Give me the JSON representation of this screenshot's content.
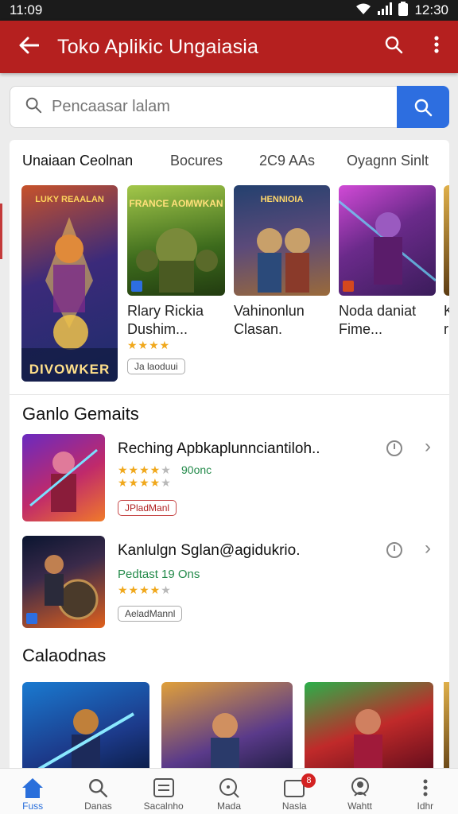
{
  "status": {
    "time": "11:09",
    "right_time": "12:30"
  },
  "appbar": {
    "title": "Toko Aplikic Ungaiasia"
  },
  "search": {
    "placeholder": "Pencaasar lalam"
  },
  "tabs": [
    "Unaiaan Ceolnan",
    "Bocures",
    "2C9 AAs",
    "Oyagnn Sinlt"
  ],
  "featured": [
    {
      "name_line1": "",
      "name_line2": "",
      "banner": "DIVOWKER",
      "banner_top": "LUKY REAALAN",
      "tag": "",
      "stars": 0,
      "colors": [
        "#1d2d6b",
        "#c7522a"
      ]
    },
    {
      "name_line1": "Rlary Rickia",
      "name_line2": "Dushim...",
      "stars": 4,
      "tag": "Ja laoduui",
      "banner_top": "FRANCE AOMWKAN",
      "colors": [
        "#3c6a1c",
        "#a3c74a"
      ]
    },
    {
      "name_line1": "Vahinonlun",
      "name_line2": "Clasan.",
      "stars": 0,
      "tag": "",
      "banner_top": "HENNIOIA",
      "colors": [
        "#23406e",
        "#9a6a3a"
      ]
    },
    {
      "name_line1": "Noda daniat",
      "name_line2": "Fime...",
      "stars": 0,
      "tag": "",
      "banner_top": "",
      "colors": [
        "#3a1c5a",
        "#d14ad6"
      ]
    },
    {
      "name_line1": "K",
      "name_line2": "r",
      "stars": 0,
      "tag": "",
      "banner_top": "",
      "colors": [
        "#5a3a12",
        "#e0b04a"
      ]
    }
  ],
  "section1": {
    "title": "Ganlo Gemaits"
  },
  "list": [
    {
      "title": "Reching Apbkaplunnciantiloh..",
      "sub": "90onc",
      "stars1": 4,
      "stars2": 4,
      "tag": "JPladManl"
    },
    {
      "title": "Kanlulgn Sglan@agidukrio.",
      "sub": "Pedtast 19 Ons",
      "stars1": 0,
      "stars2": 4,
      "tag": "AeladMannl"
    }
  ],
  "section2": {
    "title": "Calaodnas"
  },
  "bottom": [
    {
      "label": "Fuss",
      "icon": "home-icon"
    },
    {
      "label": "Danas",
      "icon": "search-icon"
    },
    {
      "label": "Sacalnho",
      "icon": "list-icon"
    },
    {
      "label": "Mada",
      "icon": "magnify-icon"
    },
    {
      "label": "Nasla",
      "icon": "inbox-icon",
      "badge": "8"
    },
    {
      "label": "Wahtt",
      "icon": "account-icon"
    },
    {
      "label": "Idhr",
      "icon": "more-icon"
    }
  ],
  "colors": {
    "appbar": "#b5201f",
    "accent": "#2d6ee0",
    "star": "#f0a81c"
  }
}
